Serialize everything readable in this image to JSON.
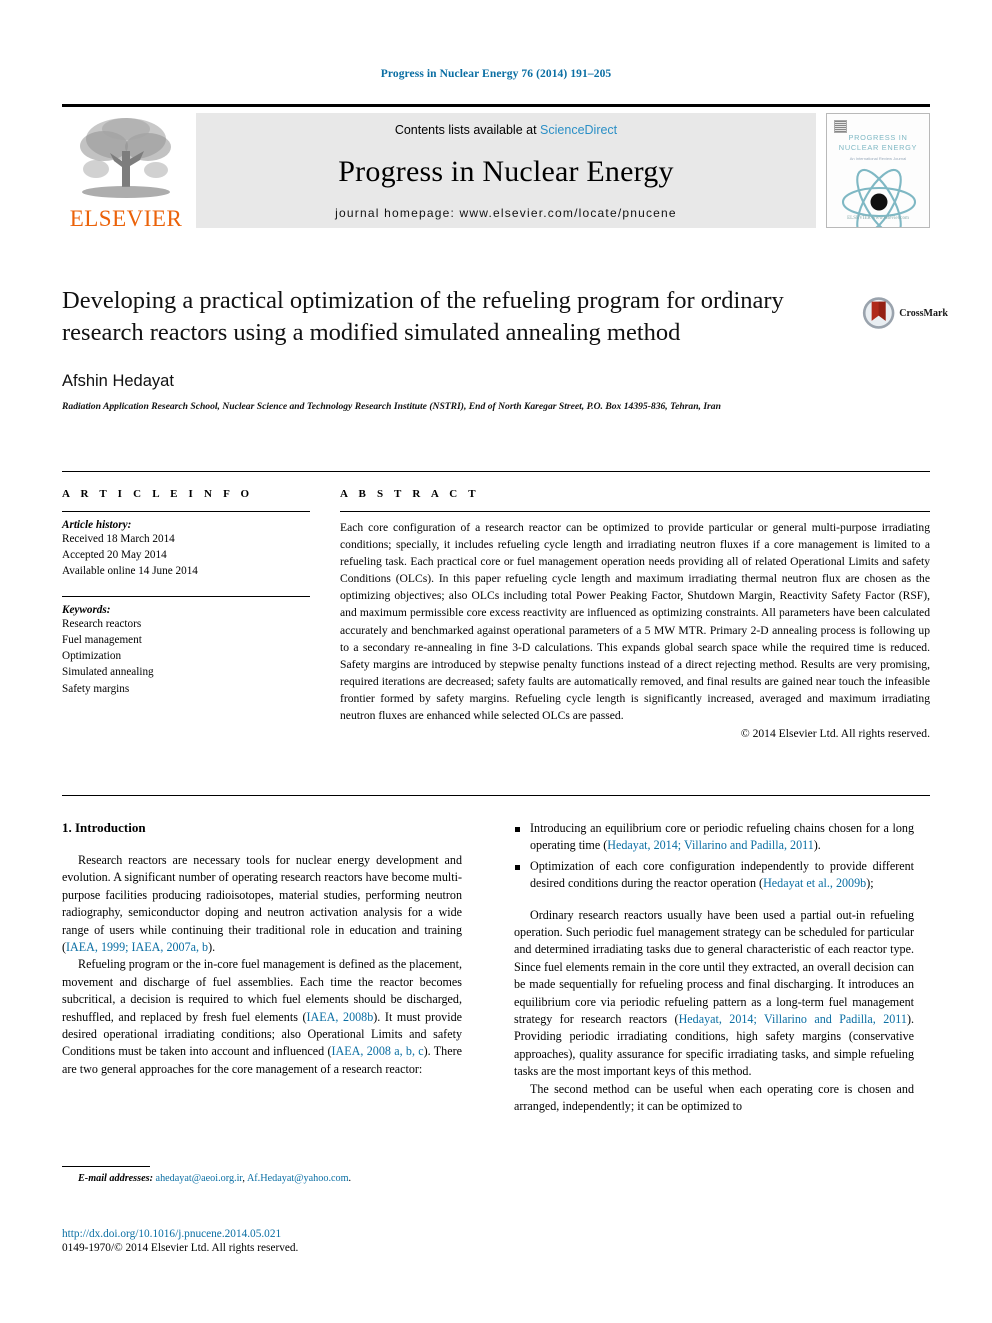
{
  "running_head": "Progress in Nuclear Energy 76 (2014) 191–205",
  "masthead": {
    "publisher_logo_text": "ELSEVIER",
    "contents_prefix": "Contents lists available at",
    "contents_link": "ScienceDirect",
    "journal_name": "Progress in Nuclear Energy",
    "homepage_line": "journal homepage: www.elsevier.com/locate/pnucene",
    "cover": {
      "title_line1": "PROGRESS IN",
      "title_line2": "NUCLEAR ENERGY",
      "subtitle": "An International Review Journal",
      "footer": "ELSEVIER  www.elsevier.com"
    }
  },
  "article": {
    "title": "Developing a practical optimization of the refueling program for ordinary research reactors using a modified simulated annealing method",
    "author": "Afshin Hedayat",
    "affiliation": "Radiation Application Research School, Nuclear Science and Technology Research Institute (NSTRI), End of North Karegar Street, P.O. Box 14395-836, Tehran, Iran",
    "crossmark_label": "CrossMark"
  },
  "info": {
    "heading": "A R T I C L E   I N F O",
    "history_label": "Article history:",
    "history": [
      "Received 18 March 2014",
      "Accepted 20 May 2014",
      "Available online 14 June 2014"
    ],
    "keywords_label": "Keywords:",
    "keywords": [
      "Research reactors",
      "Fuel management",
      "Optimization",
      "Simulated annealing",
      "Safety margins"
    ]
  },
  "abstract": {
    "heading": "A B S T R A C T",
    "text": "Each core configuration of a research reactor can be optimized to provide particular or general multi-purpose irradiating conditions; specially, it includes refueling cycle length and irradiating neutron fluxes if a core management is limited to a refueling task. Each practical core or fuel management operation needs providing all of related Operational Limits and safety Conditions (OLCs). In this paper refueling cycle length and maximum irradiating thermal neutron flux are chosen as the optimizing objectives; also OLCs including total Power Peaking Factor, Shutdown Margin, Reactivity Safety Factor (RSF), and maximum permissible core excess reactivity are influenced as optimizing constraints. All parameters have been calculated accurately and benchmarked against operational parameters of a 5 MW MTR. Primary 2-D annealing process is following up to a secondary re-annealing in fine 3-D calculations. This expands global search space while the required time is reduced. Safety margins are introduced by stepwise penalty functions instead of a direct rejecting method. Results are very promising, required iterations are decreased; safety faults are automatically removed, and final results are gained near touch the infeasible frontier formed by safety margins. Refueling cycle length is significantly increased, averaged and maximum irradiating neutron fluxes are enhanced while selected OLCs are passed.",
    "copyright": "© 2014 Elsevier Ltd. All rights reserved."
  },
  "body": {
    "section_heading": "1. Introduction",
    "left_paragraphs": [
      {
        "parts": [
          {
            "t": "Research reactors are necessary tools for nuclear energy development and evolution. A significant number of operating research reactors have become multi-purpose facilities producing radioisotopes, material studies, performing neutron radiography, semiconductor doping and neutron activation analysis for a wide range of users while continuing their traditional role in education and training (",
            "link": false
          },
          {
            "t": "IAEA, 1999; IAEA, 2007a, b",
            "link": true
          },
          {
            "t": ").",
            "link": false
          }
        ]
      },
      {
        "parts": [
          {
            "t": "Refueling program or the in-core fuel management is defined as the placement, movement and discharge of fuel assemblies. Each time the reactor becomes subcritical, a decision is required to which fuel elements should be discharged, reshuffled, and replaced by fresh fuel elements (",
            "link": false
          },
          {
            "t": "IAEA, 2008b",
            "link": true
          },
          {
            "t": "). It must provide desired operational irradiating conditions; also Operational Limits and safety Conditions must be taken into account and influenced (",
            "link": false
          },
          {
            "t": "IAEA, 2008 a, b, c",
            "link": true
          },
          {
            "t": "). There are two general approaches for the core management of a research reactor:",
            "link": false
          }
        ]
      }
    ],
    "bullets": [
      {
        "parts": [
          {
            "t": "Introducing an equilibrium core or periodic refueling chains chosen for a long operating time (",
            "link": false
          },
          {
            "t": "Hedayat, 2014; Villarino and Padilla, 2011",
            "link": true
          },
          {
            "t": ").",
            "link": false
          }
        ]
      },
      {
        "parts": [
          {
            "t": "Optimization of each core configuration independently to provide different desired conditions during the reactor operation (",
            "link": false
          },
          {
            "t": "Hedayat et al., 2009b",
            "link": true
          },
          {
            "t": ");",
            "link": false
          }
        ]
      }
    ],
    "right_paragraphs": [
      {
        "parts": [
          {
            "t": "Ordinary research reactors usually have been used a partial out-in refueling operation. Such periodic fuel management strategy can be scheduled for particular and determined irradiating tasks due to general characteristic of each reactor type. Since fuel elements remain in the core until they extracted, an overall decision can be made sequentially for refueling process and final discharging. It introduces an equilibrium core via periodic refueling pattern as a long-term fuel management strategy for research reactors (",
            "link": false
          },
          {
            "t": "Hedayat, 2014; Villarino and Padilla, 2011",
            "link": true
          },
          {
            "t": "). Providing periodic irradiating conditions, high safety margins (conservative approaches), quality assurance for specific irradiating tasks, and simple refueling tasks are the most important keys of this method.",
            "link": false
          }
        ]
      },
      {
        "parts": [
          {
            "t": "The second method can be useful when each operating core is chosen and arranged, independently; it can be optimized to",
            "link": false
          }
        ]
      }
    ]
  },
  "footnote": {
    "label": "E-mail addresses:",
    "emails": [
      "ahedayat@aeoi.org.ir",
      "Af.Hedayat@yahoo.com"
    ],
    "separator": ", ",
    "terminator": "."
  },
  "footer": {
    "doi": "http://dx.doi.org/10.1016/j.pnucene.2014.05.021",
    "issn_line": "0149-1970/© 2014 Elsevier Ltd. All rights reserved."
  },
  "colors": {
    "link_blue": "#0a6ea3",
    "sciencedirect_blue": "#2b8fc6",
    "elsevier_orange": "#eb6209",
    "cover_teal": "#7fb8c4"
  }
}
